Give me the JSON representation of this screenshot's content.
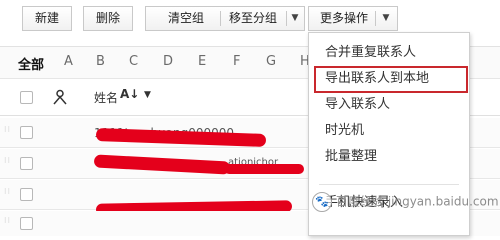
{
  "toolbar": {
    "new_label": "新建",
    "delete_label": "删除",
    "clear_group_label": "清空组",
    "move_to_group_label": "移至分组",
    "more_actions_label": "更多操作"
  },
  "alphabet": {
    "all_label": "全部",
    "letters": [
      "A",
      "B",
      "C",
      "D",
      "E",
      "F",
      "G",
      "H"
    ]
  },
  "list_header": {
    "name_label": "姓名",
    "sort_icon_label": "A↓Z"
  },
  "rows": [
    {
      "visible_text": "1111tanshuang000000",
      "redacted": true
    },
    {
      "visible_text": "ationichor",
      "redacted": true
    },
    {
      "visible_text": "",
      "redacted": true
    }
  ],
  "more_menu": {
    "items": [
      {
        "label": "合并重复联系人",
        "highlighted": false
      },
      {
        "label": "导出联系人到本地",
        "highlighted": true
      },
      {
        "label": "导入联系人",
        "highlighted": false
      },
      {
        "label": "时光机",
        "highlighted": false
      },
      {
        "label": "批量整理",
        "highlighted": false
      },
      {
        "label": "手机快速录入",
        "highlighted": false
      }
    ],
    "highlight_color": "#c9282d"
  },
  "watermark": {
    "text": "百度经验 jingyan.baidu.com"
  },
  "colors": {
    "redaction": "#e4001b",
    "highlight_box": "#c9282d"
  }
}
